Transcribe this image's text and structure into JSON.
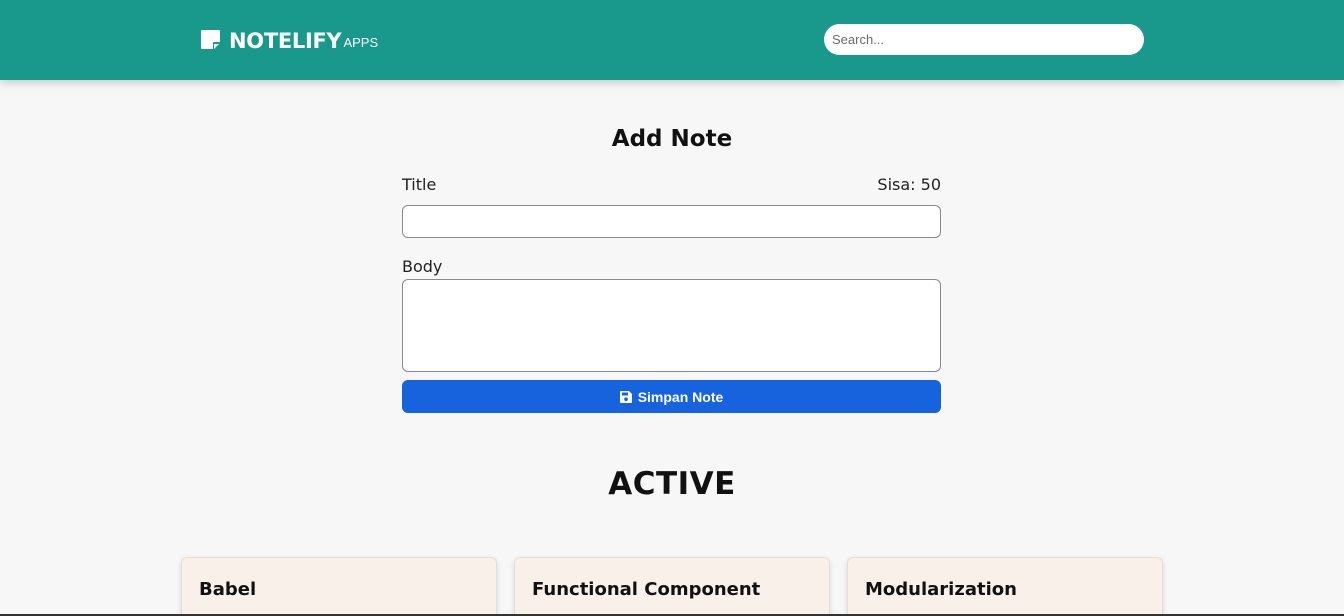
{
  "header": {
    "brand_main": "NOTELIFY",
    "brand_sub": "APPS",
    "search_placeholder": "Search...",
    "bg_color": "#19988c"
  },
  "form": {
    "heading": "Add Note",
    "title_label": "Title",
    "counter": "Sisa: 50",
    "title_value": "",
    "body_label": "Body",
    "body_value": "",
    "save_label": "Simpan Note",
    "save_icon": "floppy-disk-icon",
    "button_color": "#1763de"
  },
  "section": {
    "heading": "ACTIVE"
  },
  "notes": [
    {
      "title": "Babel"
    },
    {
      "title": "Functional Component"
    },
    {
      "title": "Modularization"
    }
  ]
}
